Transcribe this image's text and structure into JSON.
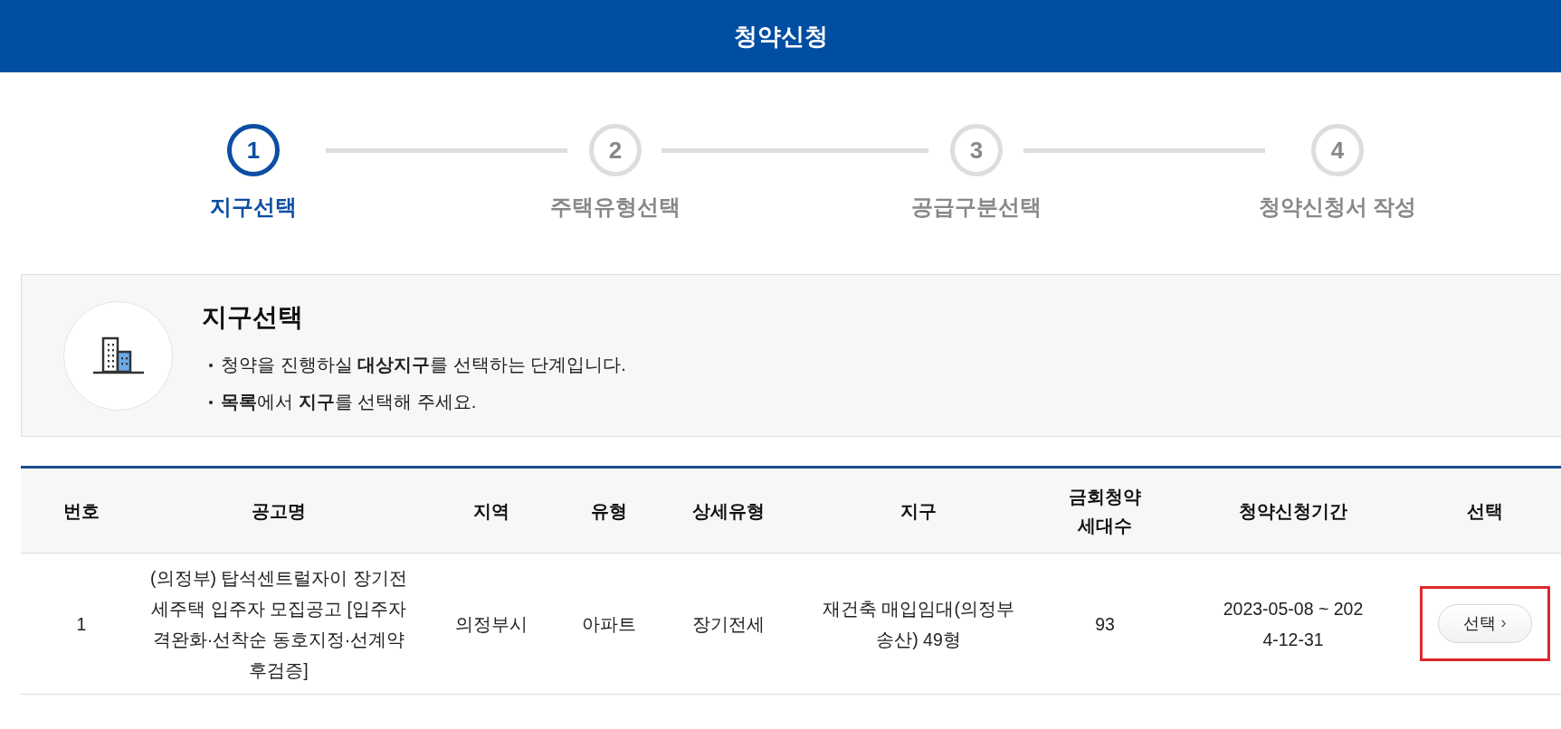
{
  "header": {
    "title": "청약신청"
  },
  "steps": [
    {
      "number": "1",
      "label": "지구선택",
      "selected": true
    },
    {
      "number": "2",
      "label": "주택유형선택",
      "selected": false
    },
    {
      "number": "3",
      "label": "공급구분선택",
      "selected": false
    },
    {
      "number": "4",
      "label": "청약신청서 작성",
      "selected": false
    }
  ],
  "intro": {
    "title": "지구선택",
    "bullets": [
      "청약을 진행하실 **대상지구**를 선택하는 단계입니다.",
      "**목록**에서 **지구**를 선택해 주세요."
    ]
  },
  "table": {
    "columns": [
      "번호",
      "공고명",
      "지역",
      "유형",
      "상세유형",
      "지구",
      "금회청약 세대수",
      "청약신청기간",
      "선택"
    ],
    "rows": [
      {
        "cells": [
          "1",
          "(의정부) 탑석센트럴자이 장기전세주택 입주자 모집공고 [입주자격완화·선착순 동호지정·선계약 후검증]",
          "의정부시",
          "아파트",
          "장기전세",
          "재건축 매입임대(의정부송산) 49형",
          "93",
          "2023-05-08 ~ 2024-12-31"
        ],
        "action": "선택",
        "highlighted": true
      }
    ]
  }
}
